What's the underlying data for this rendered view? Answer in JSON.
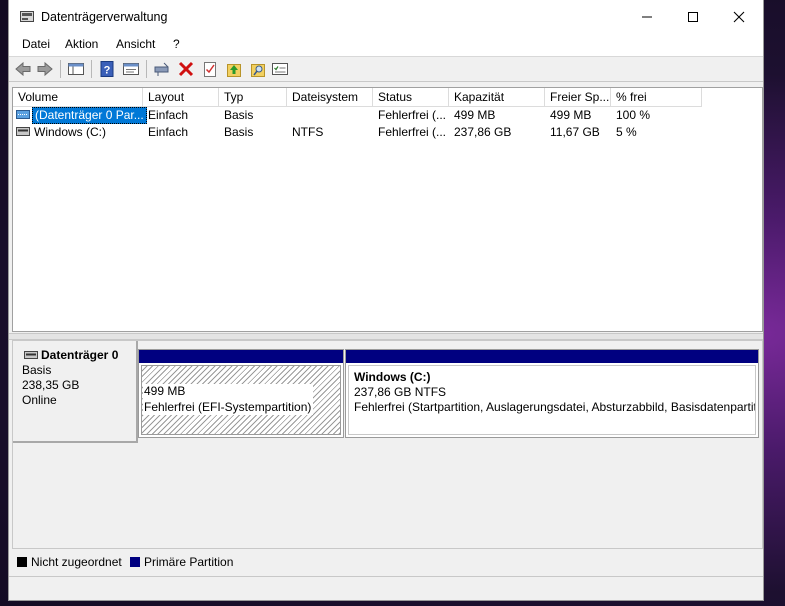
{
  "window": {
    "title": "Datenträgerverwaltung"
  },
  "menu": [
    "Datei",
    "Aktion",
    "Ansicht",
    "?"
  ],
  "toolbar": [
    "back-arrow-icon",
    "forward-arrow-icon",
    "console-tree-icon",
    "help-icon",
    "properties-icon",
    "connect-icon",
    "delete-icon",
    "check-icon",
    "folder-up-icon",
    "search-folder-icon",
    "list-icon"
  ],
  "table": {
    "headers": [
      "Volume",
      "Layout",
      "Typ",
      "Dateisystem",
      "Status",
      "Kapazität",
      "Freier Sp...",
      "% frei"
    ],
    "rows": [
      [
        "(Datenträger 0 Par...",
        "Einfach",
        "Basis",
        "",
        "Fehlerfrei (...",
        "499 MB",
        "499 MB",
        "100 %"
      ],
      [
        "Windows (C:)",
        "Einfach",
        "Basis",
        "NTFS",
        "Fehlerfrei (...",
        "237,86 GB",
        "11,67 GB",
        "5 %"
      ]
    ]
  },
  "disk": {
    "name": "Datenträger 0",
    "type": "Basis",
    "size": "238,35 GB",
    "state": "Online",
    "partitions": [
      {
        "title": "",
        "size": "499 MB",
        "status": "Fehlerfrei (EFI-Systempartition)"
      },
      {
        "title": "Windows  (C:)",
        "size": "237,86 GB NTFS",
        "status": "Fehlerfrei (Startpartition, Auslagerungsdatei, Absturzabbild, Basisdatenpartit"
      }
    ]
  },
  "legend": [
    {
      "label": "Nicht zugeordnet",
      "color": "#000000"
    },
    {
      "label": "Primäre Partition",
      "color": "#000080"
    }
  ],
  "colors": {
    "primary_partition": "#000080",
    "selection": "#0078d7"
  }
}
